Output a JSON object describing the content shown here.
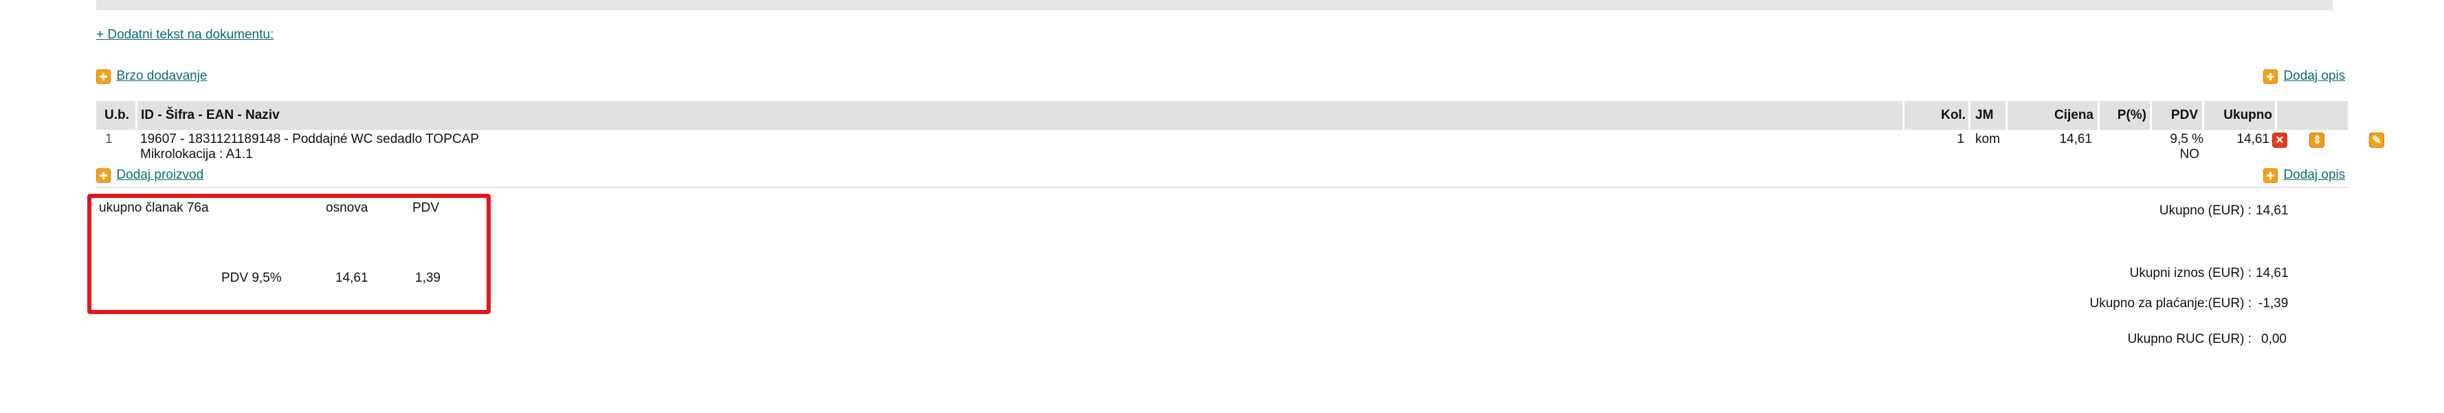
{
  "links": {
    "additional_text": "+ Dodatni tekst na dokumentu:",
    "quick_add": "Brzo dodavanje",
    "add_description": "Dodaj opis",
    "add_product": "Dodaj proizvod",
    "add_description_bottom": "Dodaj opis"
  },
  "table": {
    "headers": {
      "ub": "U.b.",
      "name": "ID - Šifra - EAN - Naziv",
      "qty": "Kol.",
      "unit": "JM",
      "price": "Cijena",
      "discount": "P(%)",
      "vat": "PDV",
      "total": "Ukupno"
    },
    "row": {
      "ub": "1",
      "name": "19607 - 1831121189148 - Poddajné WC sedadlo TOPCAP",
      "location": "Mikrolokacija : A1.1",
      "qty": "1",
      "unit": "kom",
      "price": "14,61",
      "discount": "",
      "vat": "9,5 %",
      "vat_code": "NO",
      "total": "14,61"
    }
  },
  "vat_summary": {
    "header_label": "ukupno članak 76a",
    "header_base": "osnova",
    "header_vat": "PDV",
    "row_label": "PDV 9,5%",
    "row_base": "14,61",
    "row_vat": "1,39"
  },
  "totals": {
    "total_label": "Ukupno (EUR) :",
    "total_value": "14,61",
    "amount_label": "Ukupni iznos (EUR) :",
    "amount_value": "14,61",
    "payable_label": "Ukupno za plaćanje:(EUR) :",
    "payable_value": "-1,39",
    "ruc_label": "Ukupno RUC (EUR) :",
    "ruc_value": "0,00"
  },
  "colors": {
    "link": "#0b6b78",
    "highlight_box": "#e8141c",
    "header_bg": "#e1e1e1"
  }
}
